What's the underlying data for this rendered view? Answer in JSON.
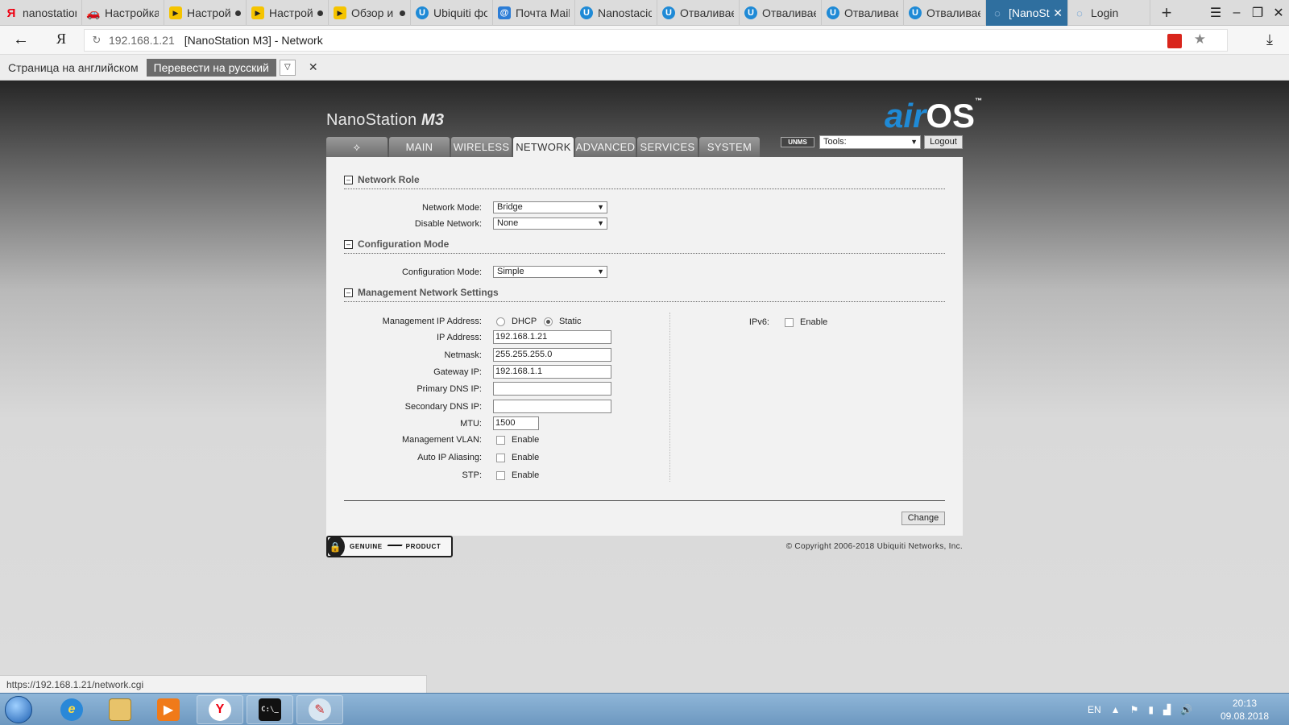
{
  "browser": {
    "tabs": [
      {
        "label": "nanostation",
        "icon": "yandex-icon"
      },
      {
        "label": "Настройка",
        "icon": "car-icon"
      },
      {
        "label": "Настрой",
        "icon": "play-icon"
      },
      {
        "label": "Настрой",
        "icon": "play-icon"
      },
      {
        "label": "Обзор и",
        "icon": "play-icon"
      },
      {
        "label": "Ubiquiti фо",
        "icon": "ubiquiti-icon"
      },
      {
        "label": "Почта Mail",
        "icon": "mail-icon"
      },
      {
        "label": "Nanostacio",
        "icon": "ubiquiti-icon"
      },
      {
        "label": "Отваливае",
        "icon": "ubiquiti-icon"
      },
      {
        "label": "Отваливае",
        "icon": "ubiquiti-icon"
      },
      {
        "label": "Отваливае",
        "icon": "ubiquiti-icon"
      },
      {
        "label": "Отваливае",
        "icon": "ubiquiti-icon"
      },
      {
        "label": "[NanoSt",
        "icon": "wireless-icon",
        "active": true
      },
      {
        "label": "Login",
        "icon": "wireless-icon"
      }
    ],
    "address": {
      "host": "192.168.1.21",
      "title": "[NanoStation M3] - Network"
    },
    "ya_logo": "Я",
    "translate": {
      "text": "Страница на английском",
      "button": "Перевести на русский"
    },
    "status_url": "https://192.168.1.21/network.cgi"
  },
  "airos": {
    "product_name": "NanoStation",
    "product_model": "M3",
    "brand_air": "air",
    "brand_os": "OS",
    "brand_tm": "™",
    "nav_tabs": [
      "MAIN",
      "WIRELESS",
      "NETWORK",
      "ADVANCED",
      "SERVICES",
      "SYSTEM"
    ],
    "active_tab": "NETWORK",
    "unms_label": "UNMS",
    "tools_label": "Tools:",
    "logout_label": "Logout",
    "sections": {
      "network_role": "Network Role",
      "configuration_mode": "Configuration Mode",
      "management": "Management Network Settings"
    },
    "fields": {
      "network_mode_label": "Network Mode:",
      "network_mode_value": "Bridge",
      "disable_network_label": "Disable Network:",
      "disable_network_value": "None",
      "configuration_mode_label": "Configuration Mode:",
      "configuration_mode_value": "Simple",
      "mgmt_ip_label": "Management IP Address:",
      "dhcp_label": "DHCP",
      "static_label": "Static",
      "mgmt_ip_mode": "Static",
      "ip_label": "IP Address:",
      "ip_value": "192.168.1.21",
      "netmask_label": "Netmask:",
      "netmask_value": "255.255.255.0",
      "gateway_label": "Gateway IP:",
      "gateway_value": "192.168.1.1",
      "dns1_label": "Primary DNS IP:",
      "dns1_value": "",
      "dns2_label": "Secondary DNS IP:",
      "dns2_value": "",
      "mtu_label": "MTU:",
      "mtu_value": "1500",
      "vlan_label": "Management VLAN:",
      "alias_label": "Auto IP Aliasing:",
      "stp_label": "STP:",
      "ipv6_label": "IPv6:",
      "enable_label": "Enable"
    },
    "change_label": "Change",
    "genuine": {
      "left": "GENUINE",
      "right": "PRODUCT"
    },
    "copyright": "© Copyright 2006-2018 Ubiquiti Networks, Inc."
  },
  "taskbar": {
    "lang": "EN",
    "time": "20:13",
    "date": "09.08.2018"
  },
  "colors": {
    "accent": "#1f8ad6",
    "active_tab": "#2f6f9f"
  }
}
